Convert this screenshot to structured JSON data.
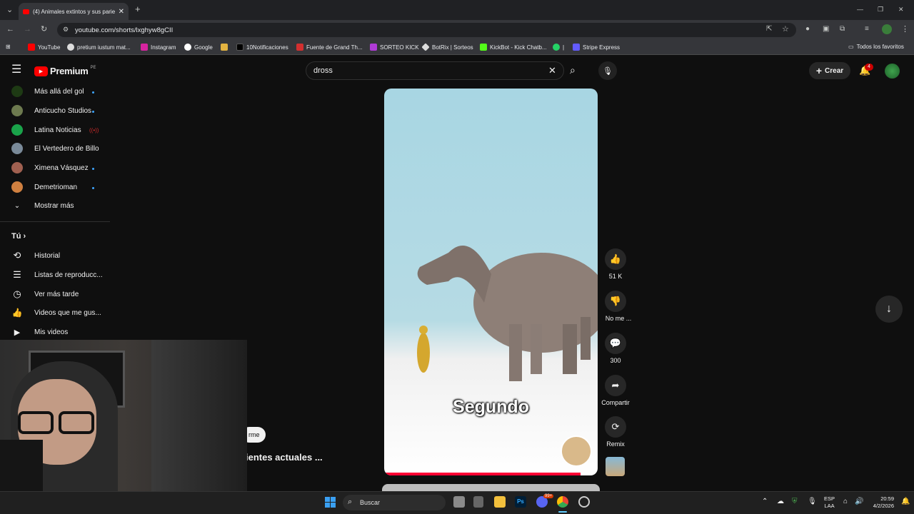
{
  "browser": {
    "tab_title": "(4) Animales extintos y sus parie",
    "url": "youtube.com/shorts/lxghyw8gCII",
    "bookmarks": [
      "YouTube",
      "pretium iustum mat...",
      "Instagram",
      "Google",
      "",
      "10Notificaciones",
      "Fuente de Grand Th...",
      "SORTEO KICK",
      "BotRix | Sorteos",
      "KickBot - Kick Chatb...",
      "|",
      "Stripe Express"
    ],
    "all_bookmarks": "Todos los favoritos"
  },
  "youtube": {
    "logo": "Premium",
    "region": "PE",
    "search_value": "dross",
    "create_label": "Crear",
    "notif_count": "4",
    "subscriptions": [
      "Más allá del gol",
      "Anticucho Studios",
      "Latina Noticias",
      "El Vertedero de Billo",
      "Ximena Vásquez",
      "Demetrioman"
    ],
    "show_more": "Mostrar más",
    "you_label": "Tú",
    "you_items": [
      "Historial",
      "Listas de reproducc...",
      "Ver más tarde",
      "Videos que me gus...",
      "Mis videos"
    ]
  },
  "short": {
    "caption": "Segundo",
    "likes": "51 K",
    "dislike_label": "No me ...",
    "comments": "300",
    "share_label": "Compartir",
    "remix_label": "Remix",
    "partial_chip": "rme",
    "partial_title": "ientes actuales ..."
  },
  "taskbar": {
    "search_label": "Buscar",
    "lang": "ESP",
    "lang2": "LAA",
    "time": "20:59",
    "date": "4/2/2026",
    "badge": "99+"
  }
}
